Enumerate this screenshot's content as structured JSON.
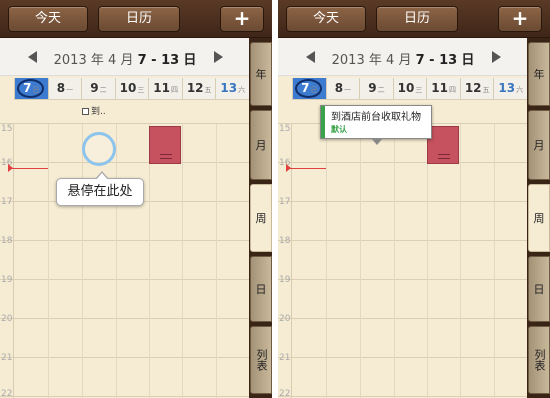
{
  "toolbar": {
    "today_label": "今天",
    "calendar_label": "日历",
    "add_label": "+"
  },
  "nav": {
    "year": "2013",
    "year_suffix": "年",
    "month": "4",
    "month_suffix": "月",
    "range": "7 - 13",
    "day_suffix": "日"
  },
  "days": [
    {
      "num": "7",
      "wk": "日"
    },
    {
      "num": "8",
      "wk": "一"
    },
    {
      "num": "9",
      "wk": "二"
    },
    {
      "num": "10",
      "wk": "三"
    },
    {
      "num": "11",
      "wk": "四"
    },
    {
      "num": "12",
      "wk": "五"
    },
    {
      "num": "13",
      "wk": "六"
    }
  ],
  "hours": [
    "15",
    "16",
    "17",
    "18",
    "19",
    "20",
    "21",
    "22"
  ],
  "event": {
    "chip_label": "到..",
    "title": "到酒店前台收取礼物",
    "calendar": "默认"
  },
  "hover_tip": "悬停在此处",
  "side_tabs": [
    "年",
    "月",
    "周",
    "日",
    "列表"
  ],
  "colors": {
    "toolbar": "#4a2f1f",
    "today": "#3d7bd0",
    "event": "#c5525e",
    "green": "#3aa24a",
    "paper": "#f6ecd3"
  }
}
